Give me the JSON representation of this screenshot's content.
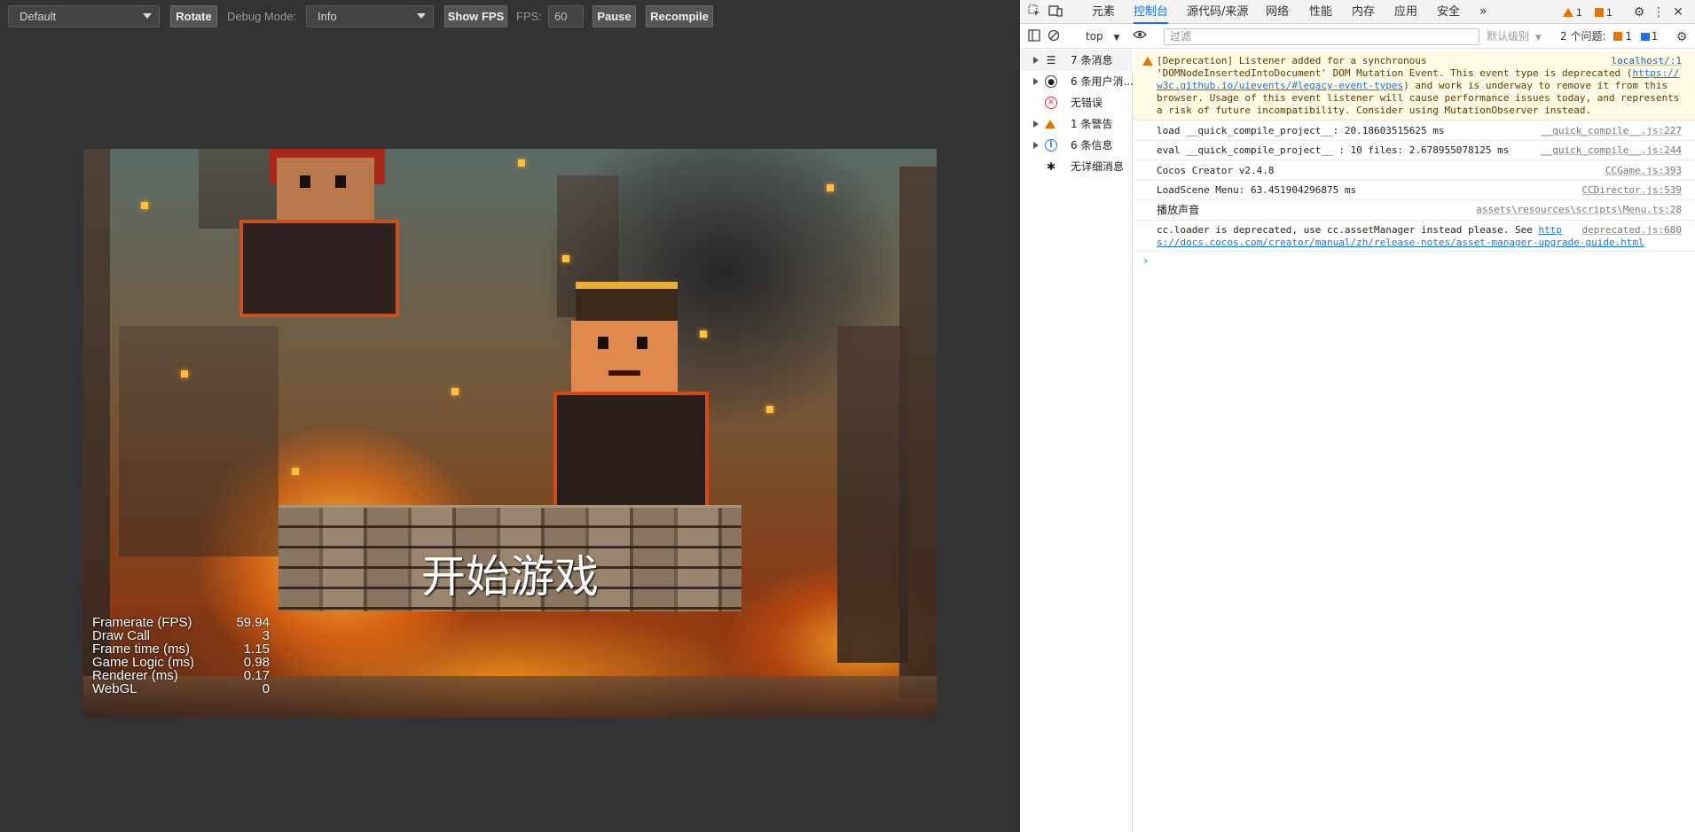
{
  "toolbar": {
    "device_select": "Default",
    "rotate": "Rotate",
    "debug_mode_label": "Debug Mode:",
    "debug_mode_value": "Info",
    "show_fps": "Show FPS",
    "fps_label": "FPS:",
    "fps_value": "60",
    "pause": "Pause",
    "recompile": "Recompile"
  },
  "game": {
    "start_button": "开始游戏",
    "stats": [
      {
        "name": "Framerate (FPS)",
        "value": "59.94"
      },
      {
        "name": "Draw Call",
        "value": "3"
      },
      {
        "name": "Frame time (ms)",
        "value": "1.15"
      },
      {
        "name": "Game Logic (ms)",
        "value": "0.98"
      },
      {
        "name": "Renderer (ms)",
        "value": "0.17"
      },
      {
        "name": "WebGL",
        "value": "0"
      }
    ]
  },
  "devtools": {
    "tabs": [
      "元素",
      "控制台",
      "源代码/来源",
      "网络",
      "性能",
      "内存",
      "应用",
      "安全"
    ],
    "active_tab": "控制台",
    "more_tabs": "»",
    "warning_count": "1",
    "issue_count": "1",
    "context": "top",
    "filter_placeholder": "过滤",
    "level": "默认级别",
    "issues_label": "2 个问题:",
    "issues_warn": "1",
    "issues_info": "1",
    "sidebar": [
      {
        "label": "7 条消息",
        "icon": "list-icon"
      },
      {
        "label": "6 条用户消...",
        "icon": "user-icon"
      },
      {
        "label": "无错误",
        "icon": "error-icon"
      },
      {
        "label": "1 条警告",
        "icon": "warning-icon"
      },
      {
        "label": "6 条信息",
        "icon": "info-icon"
      },
      {
        "label": "无详细消息",
        "icon": "bug-icon"
      }
    ],
    "messages": {
      "deprecation": {
        "line1": "[Deprecation] Listener added for a synchronous",
        "line2": "'DOMNodeInsertedIntoDocument' DOM Mutation Event. This event type is deprecated (",
        "link_a": "https://",
        "link_b": "w3c.github.io/uievents/#legacy-event-types",
        "line3": ") and work is underway to remove it from this",
        "line4": "browser. Usage of this event listener will cause performance issues today, and represents",
        "line5": "a risk of future incompatibility. Consider using MutationObserver instead.",
        "source": "localhost/:1"
      },
      "load": {
        "text": "load __quick_compile_project__: 20.18603515625 ms",
        "source": "__quick_compile__.js:227"
      },
      "eval": {
        "text": "eval __quick_compile_project__ : 10 files: 2.678955078125 ms",
        "source": "__quick_compile__.js:244"
      },
      "version": {
        "text": "Cocos Creator v2.4.8",
        "source": "CCGame.js:393"
      },
      "loadscene": {
        "text": "LoadScene Menu: 63.451904296875 ms",
        "source": "CCDirector.js:539"
      },
      "sound": {
        "text": "播放声音",
        "source": "assets\\resources\\scripts\\Menu.ts:28"
      },
      "loader": {
        "text": "cc.loader is deprecated, use cc.assetManager instead please. See ",
        "link_a": "http",
        "link_b": "s://docs.cocos.com/creator/manual/zh/release-notes/asset-manager-upgrade-guide.html",
        "source": "deprecated.js:680"
      }
    },
    "prompt": "›"
  }
}
